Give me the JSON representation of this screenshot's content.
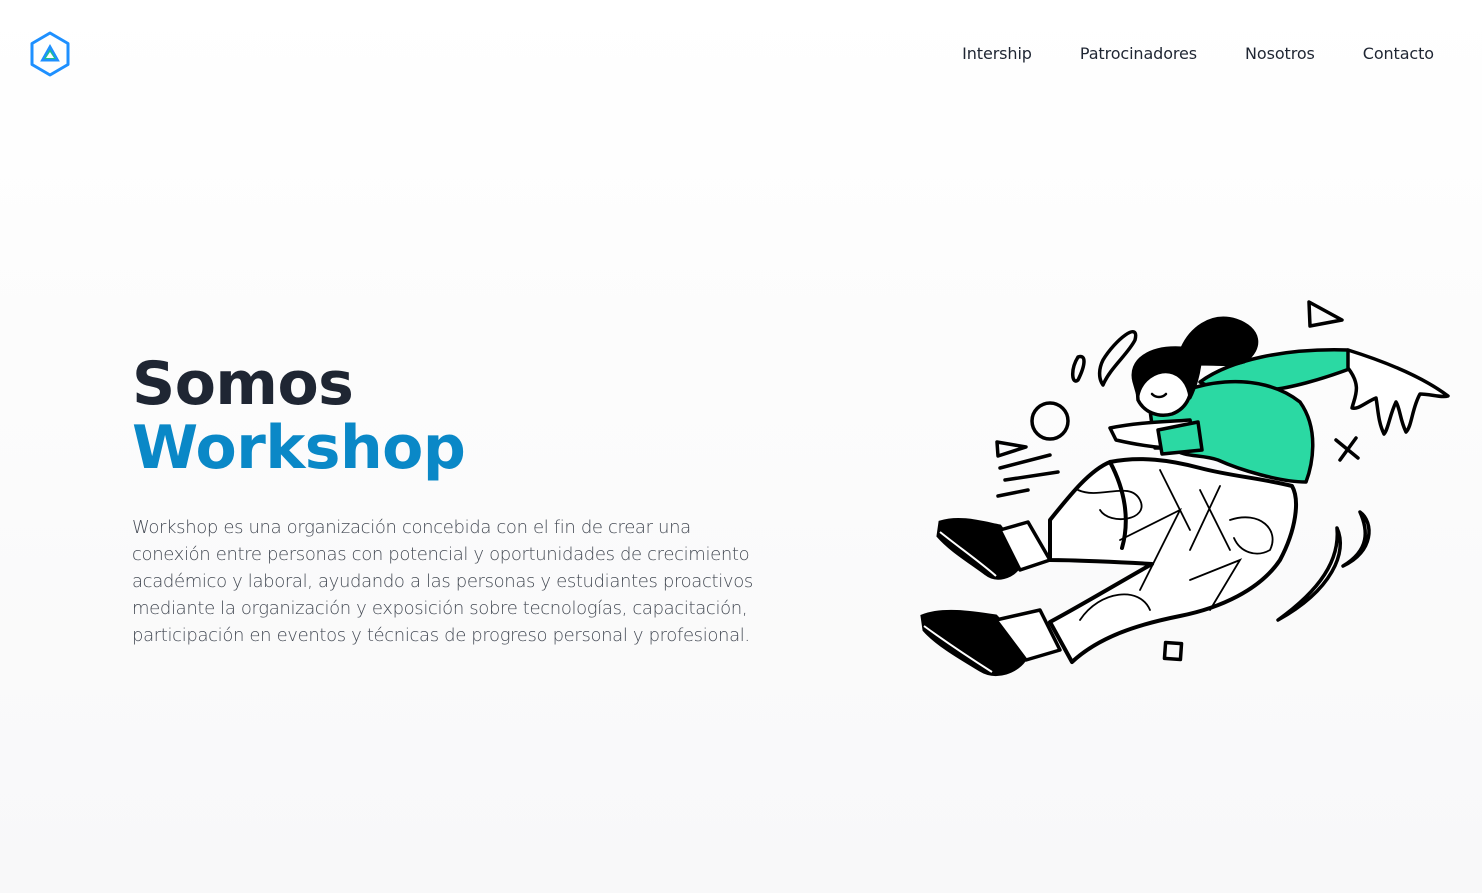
{
  "header": {
    "logo_icon": "hexagon-triangle-logo-icon",
    "logo_color": "#1e90ff",
    "logo_accent": "#1fbf8f"
  },
  "nav": {
    "items": [
      {
        "label": "Intership"
      },
      {
        "label": "Patrocinadores"
      },
      {
        "label": "Nosotros"
      },
      {
        "label": "Contacto"
      }
    ]
  },
  "hero": {
    "title_line1": "Somos",
    "title_line2": "Workshop",
    "title_color": "#1f2633",
    "accent_color": "#0a88c7",
    "description": "Workshop es una organización concebida con el fin de crear una conexión entre personas con potencial y oportunidades de crecimiento académico y laboral, ayudando a las personas y estudiantes proactivos mediante la organización y exposición sobre tecnologías, capacitación, participación en eventos y técnicas de progreso personal y profesional.",
    "illustration_icon": "jumping-person-illustration",
    "illustration_accent": "#2bd9a3"
  }
}
